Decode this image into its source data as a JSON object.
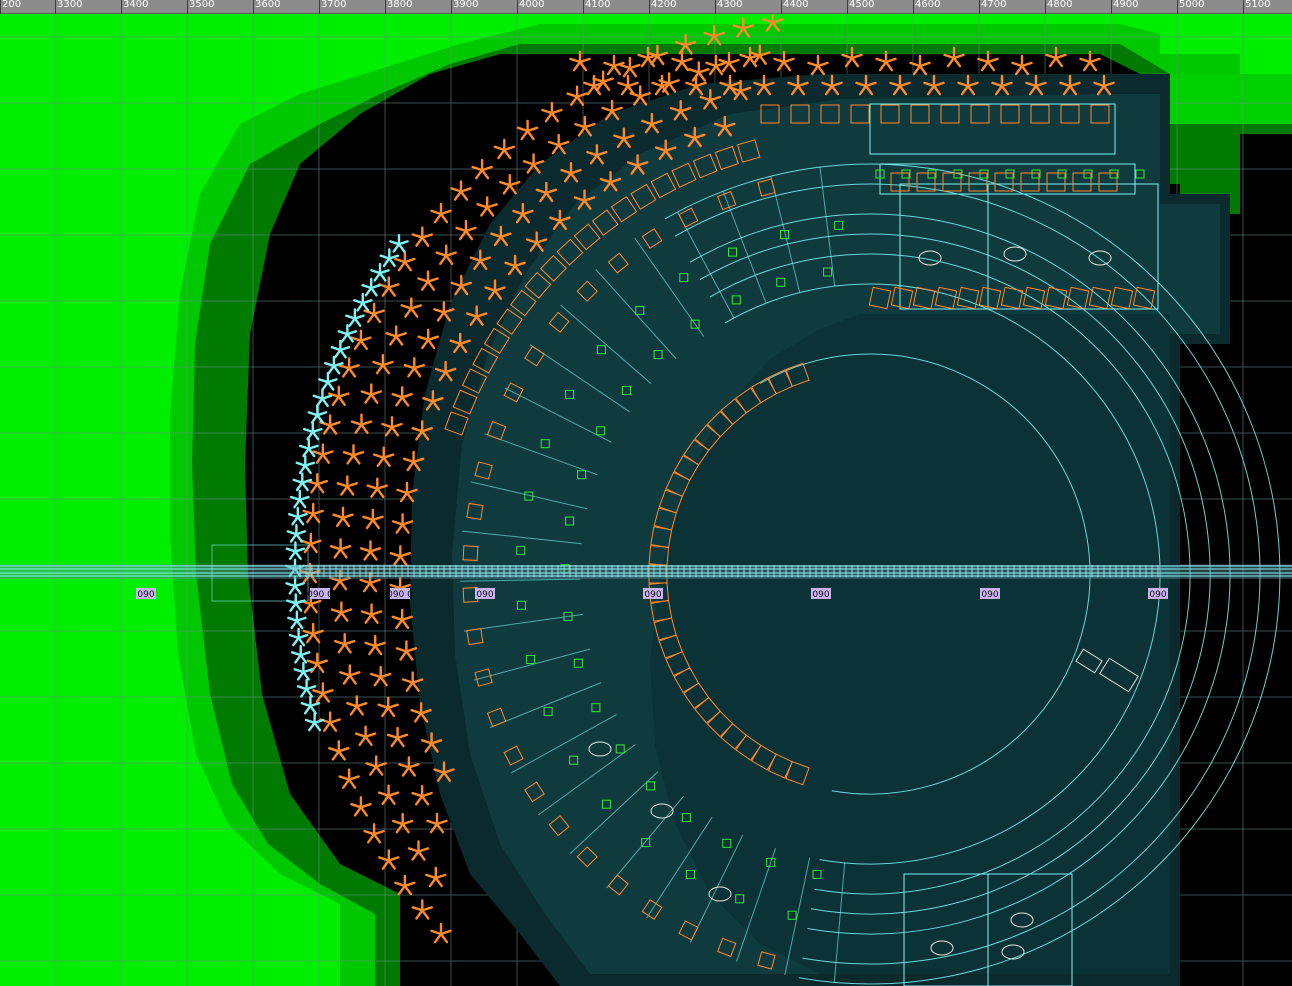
{
  "editor": {
    "view": "top-down map view",
    "colors": {
      "ruler_bg": "#8c8c8c",
      "terrain_high": "#00ee00",
      "terrain_dark": "#000000",
      "water": "#0f3a3e",
      "water_dark": "#0a2a2e",
      "grid": "#6f8f8f",
      "wire_cyan": "#7ff3f3",
      "object_orange": "#ff8a2a",
      "marker_green": "#38e838",
      "label_bg": "#c9b2f0"
    }
  },
  "ruler": {
    "ticks": [
      {
        "label": "200"
      },
      {
        "label": "3300"
      },
      {
        "label": "3400"
      },
      {
        "label": "3500"
      },
      {
        "label": "3600"
      },
      {
        "label": "3700"
      },
      {
        "label": "3800"
      },
      {
        "label": "3900"
      },
      {
        "label": "4000"
      },
      {
        "label": "4100"
      },
      {
        "label": "4200"
      },
      {
        "label": "4300"
      },
      {
        "label": "4400"
      },
      {
        "label": "4500"
      },
      {
        "label": "4600"
      },
      {
        "label": "4700"
      },
      {
        "label": "4800"
      },
      {
        "label": "4900"
      },
      {
        "label": "5000"
      },
      {
        "label": "5100"
      }
    ]
  },
  "track_labels": [
    {
      "text": "090"
    },
    {
      "text": "090 0"
    },
    {
      "text": "090 0"
    },
    {
      "text": "090"
    },
    {
      "text": "090"
    },
    {
      "text": "090"
    },
    {
      "text": "090"
    },
    {
      "text": "090"
    }
  ]
}
